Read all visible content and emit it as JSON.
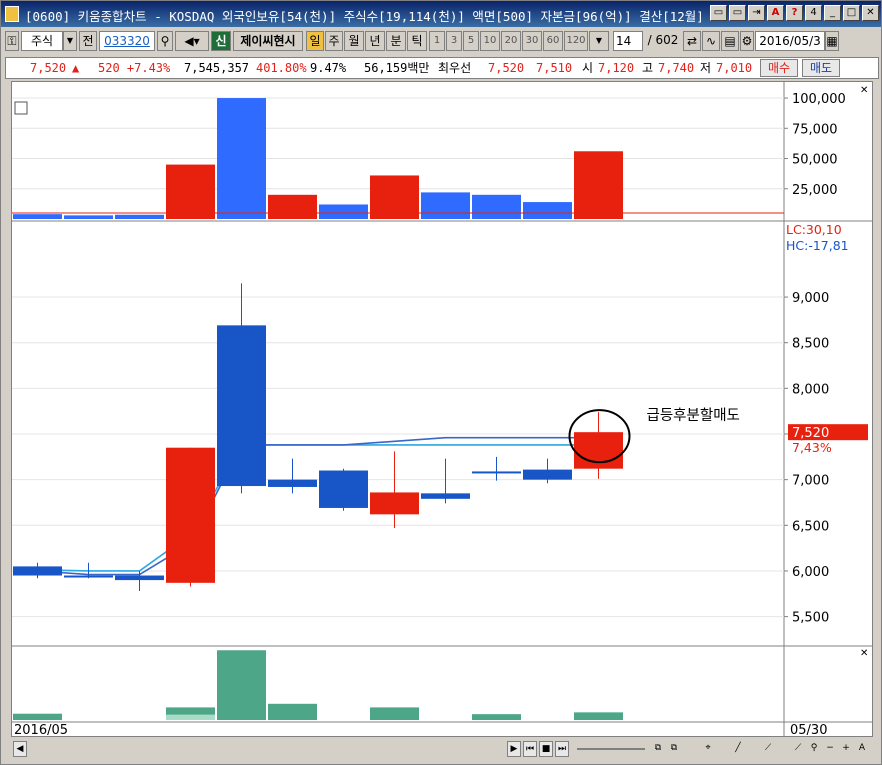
{
  "titlebar": {
    "text": "[0600] 키움종합차트 - KOSDAQ 외국인보유[54(천)] 주식수[19,114(천)] 액면[500] 자본금[96(억)] 결산[12월] ",
    "buttons": [
      "▭",
      "▭",
      "⇥",
      "A",
      "?",
      "4",
      "_",
      "□",
      "✕"
    ]
  },
  "toolbar": {
    "market": "주식",
    "all_label": "전",
    "code": "033320",
    "new_label": "신",
    "company": "제이씨현시",
    "periods": [
      "일",
      "주",
      "월",
      "년",
      "분",
      "틱"
    ],
    "minutes": [
      "1",
      "3",
      "5",
      "10",
      "20",
      "30",
      "60",
      "120"
    ],
    "count": "14",
    "total": "/ 602",
    "date": "2016/05/3"
  },
  "info": {
    "price": "7,520",
    "arrow": "▲",
    "change": "520 +7.43%",
    "volume": "7,545,357",
    "vol_ratio": "401.80%",
    "turnover": "9.47%",
    "amount": "56,159백만",
    "best_label": "최우선",
    "ask": "7,520",
    "bid": "7,510",
    "open_label": "시",
    "open": "7,120",
    "high_label": "고",
    "high": "7,740",
    "low_label": "저",
    "low": "7,010",
    "buy": "매수",
    "sell": "매도"
  },
  "colors": {
    "up": "#e8210f",
    "down": "#1856c8",
    "vol_up": "#e8210f",
    "vol_down": "#2f6bff",
    "ma": "#2aa8e0",
    "ma2": "#3a66c8",
    "sub": "#4ea688"
  },
  "chart_data": {
    "type": "candlestick",
    "price_axis": {
      "ylim": [
        5200,
        9800
      ],
      "ticks": [
        "9,000",
        "8,500",
        "8,000",
        "7,500",
        "7,000",
        "6,500",
        "6,000",
        "5,500"
      ],
      "tick_values": [
        9000,
        8500,
        8000,
        7500,
        7000,
        6500,
        6000,
        5500
      ]
    },
    "volume_axis": {
      "ylim": [
        0,
        105000
      ],
      "ticks": [
        "100,000",
        "75,000",
        "50,000",
        "25,000"
      ],
      "tick_values": [
        100000,
        75000,
        50000,
        25000
      ]
    },
    "candles": [
      {
        "o": 6050,
        "c": 5950,
        "h": 6090,
        "l": 5920
      },
      {
        "o": 5950,
        "c": 5930,
        "h": 6090,
        "l": 5920
      },
      {
        "o": 5950,
        "c": 5900,
        "h": 6000,
        "l": 5780
      },
      {
        "o": 5870,
        "c": 7350,
        "h": 7350,
        "l": 5830
      },
      {
        "o": 8690,
        "c": 6930,
        "h": 9150,
        "l": 6850
      },
      {
        "o": 7000,
        "c": 6920,
        "h": 7230,
        "l": 6850
      },
      {
        "o": 7100,
        "c": 6690,
        "h": 7120,
        "l": 6660
      },
      {
        "o": 6620,
        "c": 6860,
        "h": 7310,
        "l": 6470
      },
      {
        "o": 6850,
        "c": 6790,
        "h": 7230,
        "l": 6740
      },
      {
        "o": 7090,
        "c": 7070,
        "h": 7250,
        "l": 6990
      },
      {
        "o": 7110,
        "c": 7000,
        "h": 7230,
        "l": 6960
      },
      {
        "o": 7120,
        "c": 7520,
        "h": 7740,
        "l": 7010
      }
    ],
    "volumes": [
      4000,
      3000,
      3500,
      45000,
      100000,
      20000,
      12000,
      36000,
      22000,
      20000,
      14000,
      56000
    ],
    "volume_colors": [
      "down",
      "down",
      "down",
      "up",
      "down",
      "up",
      "down",
      "up",
      "down",
      "down",
      "down",
      "up"
    ],
    "ma_line": [
      6020,
      6000,
      6000,
      6400,
      7380,
      7380,
      7380,
      7380,
      7380,
      7380,
      7380,
      7380
    ],
    "ma_line2": [
      6020,
      5960,
      5960,
      6300,
      7380,
      7380,
      7380,
      7420,
      7460,
      7460,
      7460,
      7460
    ],
    "sub_values": [
      14,
      0,
      0,
      28,
      155,
      36,
      0,
      28,
      0,
      13,
      0,
      17
    ],
    "sub_values2": [
      0,
      0,
      0,
      12,
      0,
      0,
      0,
      0,
      0,
      0,
      0,
      0
    ],
    "sub_ylim": [
      0,
      160
    ],
    "lc": "LC:30,10",
    "hc": "HC:-17,81",
    "last_price": "7,520",
    "last_pct": "7,43%",
    "annotation": "급등후분할매도",
    "x_start": "2016/05",
    "x_end": "05/30"
  }
}
